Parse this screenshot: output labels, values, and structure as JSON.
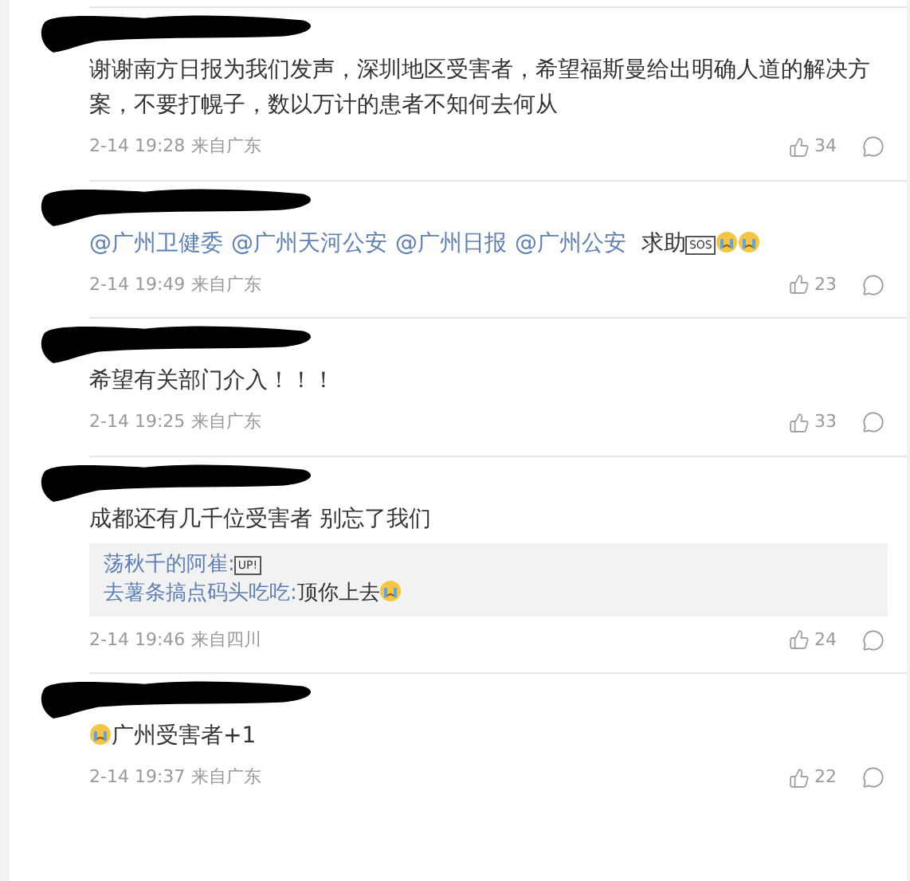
{
  "comments": [
    {
      "content": [
        {
          "kind": "text",
          "text": "谢谢南方日报为我们发声，深圳地区受害者，希望福斯曼给出明确人道的解决方案，不要打幌子，数以万计的患者不知何去何从"
        }
      ],
      "time": "2-14 19:28",
      "source": "来自广东",
      "likes": "34"
    },
    {
      "content": [
        {
          "kind": "mention",
          "text": "@广州卫健委"
        },
        {
          "kind": "mention",
          "text": "@广州天河公安"
        },
        {
          "kind": "mention",
          "text": "@广州日报"
        },
        {
          "kind": "mention",
          "text": "@广州公安"
        },
        {
          "kind": "text",
          "text": " 求助"
        },
        {
          "kind": "badge",
          "text": "SOS"
        },
        {
          "kind": "emoji"
        },
        {
          "kind": "emoji"
        }
      ],
      "time": "2-14 19:49",
      "source": "来自广东",
      "likes": "23"
    },
    {
      "content": [
        {
          "kind": "text",
          "text": "希望有关部门介入！！！"
        }
      ],
      "time": "2-14 19:25",
      "source": "来自广东",
      "likes": "33"
    },
    {
      "content": [
        {
          "kind": "text",
          "text": "成都还有几千位受害者 别忘了我们"
        }
      ],
      "replies": [
        {
          "author": "荡秋千的阿崔:",
          "content": [
            {
              "kind": "badge",
              "text": "UP!"
            }
          ]
        },
        {
          "author": "去薯条搞点码头吃吃:",
          "content": [
            {
              "kind": "text",
              "text": "顶你上去"
            },
            {
              "kind": "emoji"
            }
          ]
        }
      ],
      "time": "2-14 19:46",
      "source": "来自四川",
      "likes": "24"
    },
    {
      "content": [
        {
          "kind": "emoji"
        },
        {
          "kind": "text",
          "text": "广州受害者+1"
        }
      ],
      "time": "2-14 19:37",
      "source": "来自广东",
      "likes": "22"
    }
  ]
}
